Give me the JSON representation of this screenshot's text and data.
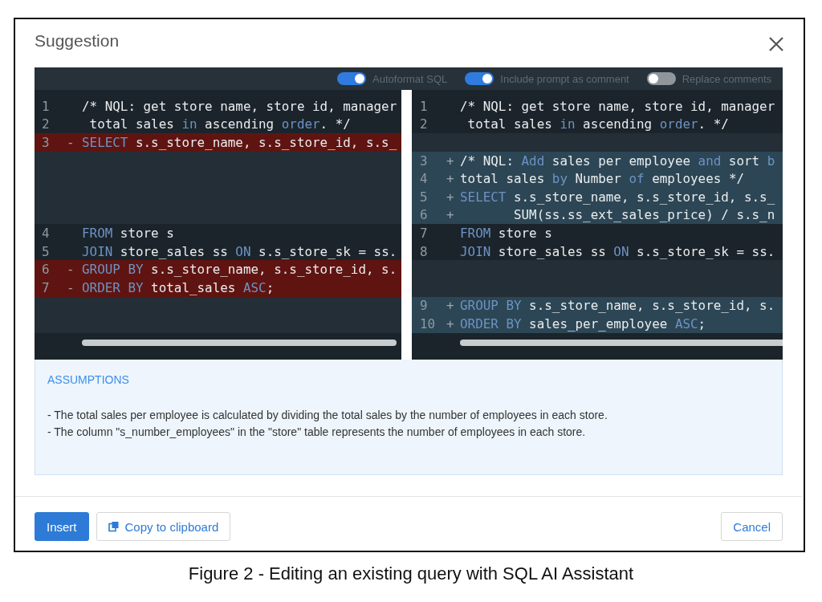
{
  "dialog": {
    "title": "Suggestion"
  },
  "toggles": [
    {
      "label": "Autoformat SQL",
      "on": true
    },
    {
      "label": "Include prompt as comment",
      "on": true
    },
    {
      "label": "Replace comments",
      "on": false
    }
  ],
  "diff": {
    "left": [
      {
        "kind": "context",
        "number": "1",
        "tokens": [
          {
            "text": "/* NQL: get store name, store id, manager",
            "kind": "plain"
          }
        ]
      },
      {
        "kind": "context",
        "number": "2",
        "tokens": [
          {
            "text": " total sales ",
            "kind": "plain"
          },
          {
            "text": "in",
            "kind": "keyword"
          },
          {
            "text": " ascending ",
            "kind": "plain"
          },
          {
            "text": "order",
            "kind": "keyword"
          },
          {
            "text": ". */",
            "kind": "plain"
          }
        ]
      },
      {
        "kind": "removed",
        "number": "3",
        "marker": "-",
        "tokens": [
          {
            "text": "SELECT",
            "kind": "keyword"
          },
          {
            "text": " s.s_store_name, s.s_store_id, s.s_",
            "kind": "plain"
          }
        ]
      },
      {
        "kind": "filler"
      },
      {
        "kind": "filler"
      },
      {
        "kind": "filler"
      },
      {
        "kind": "filler"
      },
      {
        "kind": "context",
        "number": "4",
        "tokens": [
          {
            "text": "FROM",
            "kind": "keyword"
          },
          {
            "text": " store s",
            "kind": "plain"
          }
        ]
      },
      {
        "kind": "context",
        "number": "5",
        "tokens": [
          {
            "text": "JOIN",
            "kind": "keyword"
          },
          {
            "text": " store_sales ss ",
            "kind": "plain"
          },
          {
            "text": "ON",
            "kind": "keyword"
          },
          {
            "text": " s.s_store_sk = ss.",
            "kind": "plain"
          }
        ]
      },
      {
        "kind": "removed",
        "number": "6",
        "marker": "-",
        "tokens": [
          {
            "text": "GROUP BY",
            "kind": "keyword"
          },
          {
            "text": " s.s_store_name, s.s_store_id, s.",
            "kind": "plain"
          }
        ]
      },
      {
        "kind": "removed",
        "number": "7",
        "marker": "-",
        "tokens": [
          {
            "text": "ORDER BY",
            "kind": "keyword"
          },
          {
            "text": " total_sales ",
            "kind": "plain"
          },
          {
            "text": "ASC",
            "kind": "keyword"
          },
          {
            "text": ";",
            "kind": "plain"
          }
        ]
      },
      {
        "kind": "filler"
      },
      {
        "kind": "filler"
      }
    ],
    "right": [
      {
        "kind": "context",
        "number": "1",
        "tokens": [
          {
            "text": "/* NQL: get store name, store id, manager",
            "kind": "plain"
          }
        ]
      },
      {
        "kind": "context",
        "number": "2",
        "tokens": [
          {
            "text": " total sales ",
            "kind": "plain"
          },
          {
            "text": "in",
            "kind": "keyword"
          },
          {
            "text": " ascending ",
            "kind": "plain"
          },
          {
            "text": "order",
            "kind": "keyword"
          },
          {
            "text": ". */",
            "kind": "plain"
          }
        ]
      },
      {
        "kind": "filler"
      },
      {
        "kind": "added",
        "number": "3",
        "marker": "+",
        "tokens": [
          {
            "text": "/* NQL: ",
            "kind": "plain"
          },
          {
            "text": "Add",
            "kind": "keyword"
          },
          {
            "text": " sales per employee ",
            "kind": "plain"
          },
          {
            "text": "and",
            "kind": "keyword"
          },
          {
            "text": " sort ",
            "kind": "plain"
          },
          {
            "text": "b",
            "kind": "keyword"
          }
        ]
      },
      {
        "kind": "added",
        "number": "4",
        "marker": "+",
        "tokens": [
          {
            "text": "total sales ",
            "kind": "plain"
          },
          {
            "text": "by",
            "kind": "keyword"
          },
          {
            "text": " Number ",
            "kind": "plain"
          },
          {
            "text": "of",
            "kind": "keyword"
          },
          {
            "text": " employees */",
            "kind": "plain"
          }
        ]
      },
      {
        "kind": "added",
        "number": "5",
        "marker": "+",
        "tokens": [
          {
            "text": "SELECT",
            "kind": "keyword"
          },
          {
            "text": " s.s_store_name, s.s_store_id, s.s_",
            "kind": "plain"
          }
        ]
      },
      {
        "kind": "added",
        "number": "6",
        "marker": "+",
        "tokens": [
          {
            "text": "       SUM(ss.ss_ext_sales_price) / s.s_n",
            "kind": "plain"
          }
        ]
      },
      {
        "kind": "context",
        "number": "7",
        "tokens": [
          {
            "text": "FROM",
            "kind": "keyword"
          },
          {
            "text": " store s",
            "kind": "plain"
          }
        ]
      },
      {
        "kind": "context",
        "number": "8",
        "tokens": [
          {
            "text": "JOIN",
            "kind": "keyword"
          },
          {
            "text": " store_sales ss ",
            "kind": "plain"
          },
          {
            "text": "ON",
            "kind": "keyword"
          },
          {
            "text": " s.s_store_sk = ss.",
            "kind": "plain"
          }
        ]
      },
      {
        "kind": "filler"
      },
      {
        "kind": "filler"
      },
      {
        "kind": "added",
        "number": "9",
        "marker": "+",
        "tokens": [
          {
            "text": "GROUP BY",
            "kind": "keyword"
          },
          {
            "text": " s.s_store_name, s.s_store_id, s.",
            "kind": "plain"
          }
        ]
      },
      {
        "kind": "added",
        "number": "10",
        "marker": "+",
        "tokens": [
          {
            "text": "ORDER BY",
            "kind": "keyword"
          },
          {
            "text": " sales_per_employee ",
            "kind": "plain"
          },
          {
            "text": "ASC",
            "kind": "keyword"
          },
          {
            "text": ";",
            "kind": "plain"
          }
        ]
      }
    ]
  },
  "assumptions": {
    "heading": "ASSUMPTIONS",
    "lines": [
      "- The total sales per employee is calculated by dividing the total sales by the number of employees in each store.",
      "- The column \"s_number_employees\" in the \"store\" table represents the number of employees in each store."
    ]
  },
  "buttons": [
    {
      "label": "Insert",
      "kind": "primary"
    },
    {
      "label": "Copy to clipboard",
      "kind": "copy"
    },
    {
      "label": "Cancel",
      "kind": "secondary"
    }
  ],
  "caption": "Figure 2 - Editing an existing query with SQL AI Assistant"
}
